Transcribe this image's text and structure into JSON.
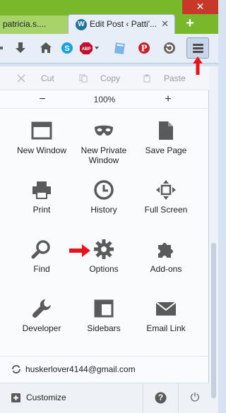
{
  "tabs": {
    "inactive_label": "patricia.s....",
    "active_label": "Edit Post ‹ Patti'...",
    "new_tab": "+",
    "window_close": "✕"
  },
  "edit": {
    "cut": "Cut",
    "copy": "Copy",
    "paste": "Paste"
  },
  "zoom": {
    "minus": "−",
    "level": "100%",
    "plus": "+"
  },
  "menu_items": [
    {
      "label": "New Window",
      "icon": "new-window-icon"
    },
    {
      "label": "New Private Window",
      "icon": "private-mask-icon"
    },
    {
      "label": "Save Page",
      "icon": "save-page-icon"
    },
    {
      "label": "Print",
      "icon": "printer-icon"
    },
    {
      "label": "History",
      "icon": "clock-icon"
    },
    {
      "label": "Full Screen",
      "icon": "fullscreen-icon"
    },
    {
      "label": "Find",
      "icon": "magnifier-icon"
    },
    {
      "label": "Options",
      "icon": "gear-icon"
    },
    {
      "label": "Add-ons",
      "icon": "puzzle-icon"
    },
    {
      "label": "Developer",
      "icon": "wrench-icon"
    },
    {
      "label": "Sidebars",
      "icon": "sidebar-icon"
    },
    {
      "label": "Email Link",
      "icon": "envelope-icon"
    }
  ],
  "account": {
    "email": "huskerlover4144@gmail.com"
  },
  "footer": {
    "customize": "Customize",
    "help": "?",
    "quit": "⏻"
  },
  "colors": {
    "tab_strip": "#78b82a",
    "annotation_arrow": "#e8141d",
    "icon_gray": "#5a5a5a"
  }
}
